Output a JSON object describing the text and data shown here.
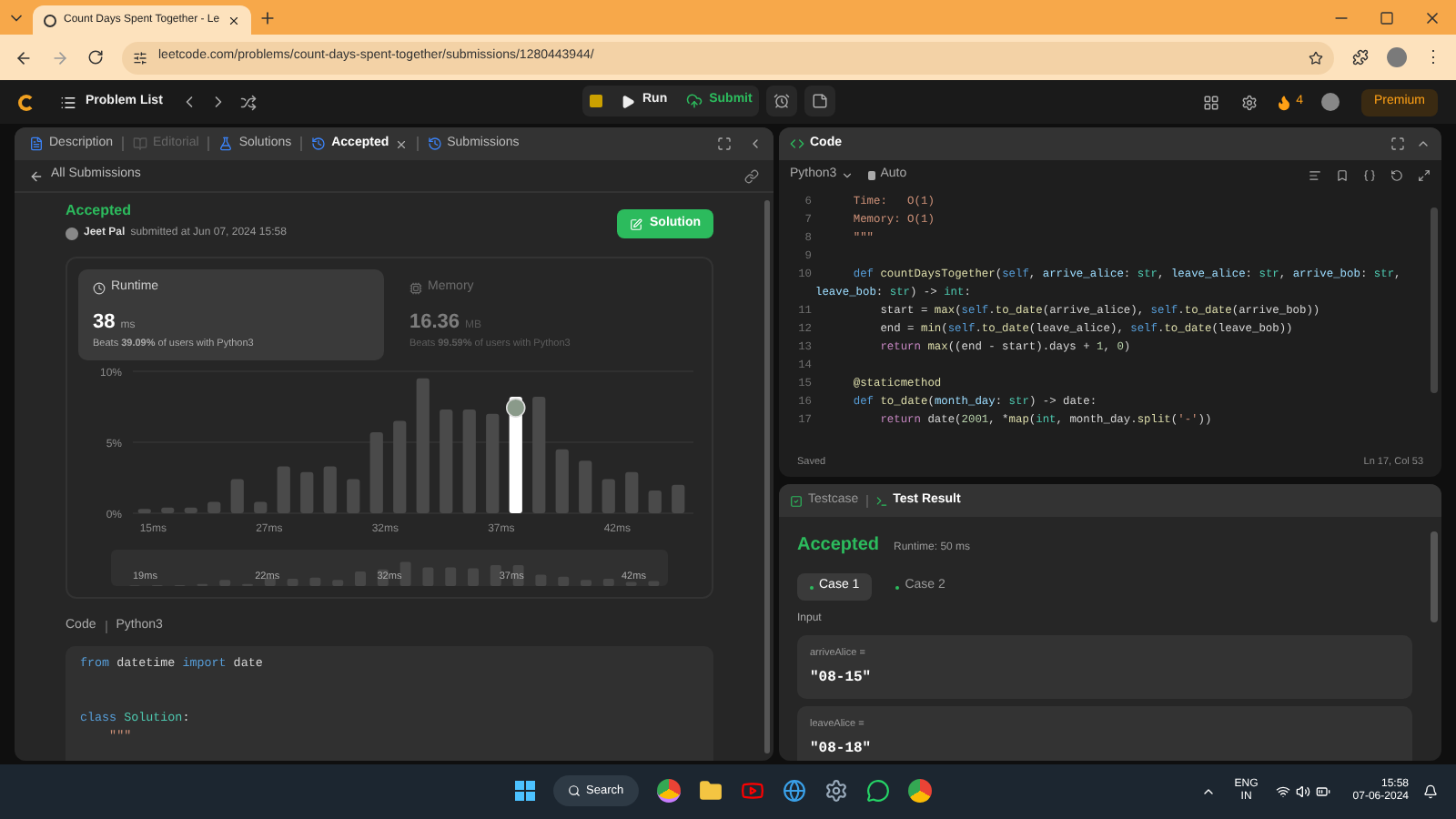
{
  "browser": {
    "tab_title": "Count Days Spent Together - Le",
    "url": "leetcode.com/problems/count-days-spent-together/submissions/1280443944/",
    "menu": "⋮"
  },
  "nav": {
    "problem_list": "Problem List",
    "run": "Run",
    "submit": "Submit",
    "streak": "4",
    "premium": "Premium"
  },
  "left_tabs": [
    {
      "label": "Description",
      "selected": false,
      "disabled": false
    },
    {
      "label": "Editorial",
      "selected": false,
      "disabled": true
    },
    {
      "label": "Solutions",
      "selected": false,
      "disabled": false
    },
    {
      "label": "Accepted",
      "selected": true,
      "disabled": false
    },
    {
      "label": "Submissions",
      "selected": false,
      "disabled": false
    }
  ],
  "back_link": "All Submissions",
  "submission": {
    "status": "Accepted",
    "user": "Jeet Pal",
    "submitted": "submitted at Jun 07, 2024 15:58",
    "solution_button": "Solution"
  },
  "stats": [
    {
      "title": "Runtime",
      "value": "38",
      "unit": "ms",
      "beats": "Beats **39.09%** of users with Python3",
      "selected": true
    },
    {
      "title": "Memory",
      "value": "16.36",
      "unit": "MB",
      "beats": "Beats **99.59%** of users with Python3",
      "selected": false
    }
  ],
  "chart_data": {
    "type": "bar",
    "categories": [
      "15ms",
      null,
      null,
      null,
      null,
      "27ms",
      null,
      null,
      null,
      null,
      "32ms",
      null,
      null,
      null,
      null,
      "37ms",
      null,
      null,
      null,
      null,
      "42ms",
      null,
      null,
      null
    ],
    "series": [
      {
        "color": "#4a4a4a",
        "values": [
          0.3,
          0.4,
          0.4,
          0.8,
          2.4,
          0.8,
          3.3,
          2.9,
          3.3,
          2.4,
          5.7,
          6.5,
          9.5,
          7.3,
          7.3,
          7.0,
          null,
          8.2,
          4.5,
          3.7,
          2.4,
          2.9,
          1.6,
          2.0
        ]
      },
      {
        "color": "#ffffff",
        "values": [
          null,
          null,
          null,
          null,
          null,
          null,
          null,
          null,
          null,
          null,
          null,
          null,
          null,
          null,
          null,
          null,
          8.2,
          null,
          null,
          null,
          null,
          null,
          null,
          null
        ]
      }
    ],
    "ylim": [
      0,
      10
    ],
    "yticks": [
      {
        "value": 0,
        "label": "0%"
      },
      {
        "value": 5,
        "label": "5%"
      },
      {
        "value": 10,
        "label": "10%"
      }
    ]
  },
  "range_labels": [
    "19ms",
    "22ms",
    "32ms",
    "37ms",
    "42ms"
  ],
  "left_code": {
    "label": "Code",
    "language": "Python3",
    "lines": [
      {
        "tokens": [
          {
            "text": "from",
            "kind": "kw"
          },
          {
            "text": " datetime ",
            "kind": "plain"
          },
          {
            "text": "import",
            "kind": "kw"
          },
          {
            "text": " date",
            "kind": "plain"
          }
        ]
      },
      {
        "kind": "blank"
      },
      {
        "kind": "blank"
      },
      {
        "kind": "code",
        "tokens": [
          {
            "text": "class ",
            "kind": "kw"
          },
          {
            "text": "Solution",
            "kind": "cls"
          },
          {
            "text": ":",
            "kind": "plain"
          }
        ]
      },
      {
        "tokens": [
          {
            "text": "    \"\"\"",
            "kind": "str"
          }
        ]
      }
    ]
  },
  "code_panel": {
    "title": "Code",
    "language": "Python3",
    "mode": "Auto",
    "status": "Saved",
    "cursor": "Ln 17, Col 53",
    "lines": [
      {
        "num": "6",
        "tokens": [
          {
            "text": "    Time:   O(1)",
            "kind": "str"
          }
        ]
      },
      {
        "num": "7",
        "tokens": [
          {
            "text": "    Memory: O(1)",
            "kind": "str"
          }
        ]
      },
      {
        "num": "8",
        "tokens": [
          {
            "text": "    \"\"\"",
            "kind": "str"
          }
        ]
      },
      {
        "num": "9"
      },
      {
        "num": "10",
        "tokens": [
          {
            "text": "    def ",
            "kind": "kw"
          },
          {
            "text": "countDaysTogether",
            "kind": "fn"
          },
          {
            "text": "(",
            "kind": "plain"
          },
          {
            "text": "self",
            "kind": "kw"
          },
          {
            "text": ", ",
            "kind": "plain"
          },
          {
            "text": "arrive_alice",
            "kind": "var"
          },
          {
            "text": ": ",
            "kind": "plain"
          },
          {
            "text": "str",
            "kind": "cls"
          },
          {
            "text": ", ",
            "kind": "plain"
          },
          {
            "text": "leave_alice",
            "kind": "var"
          },
          {
            "text": ": ",
            "kind": "plain"
          },
          {
            "text": "str",
            "kind": "cls"
          },
          {
            "text": ", ",
            "kind": "plain"
          },
          {
            "text": "arrive_bob",
            "kind": "var"
          },
          {
            "text": ": ",
            "kind": "plain"
          },
          {
            "text": "str",
            "kind": "cls"
          },
          {
            "text": ",",
            "kind": "plain"
          }
        ]
      },
      {
        "tokens": [
          {
            "text": "leave_bob",
            "kind": "var"
          },
          {
            "text": ": ",
            "kind": "plain"
          },
          {
            "text": "str",
            "kind": "cls"
          },
          {
            "text": ") -> ",
            "kind": "plain"
          },
          {
            "text": "int",
            "kind": "cls"
          },
          {
            "text": ":",
            "kind": "plain"
          }
        ]
      },
      {
        "num": "11",
        "tokens": [
          {
            "text": "        start = ",
            "kind": "plain"
          },
          {
            "text": "max",
            "kind": "fn"
          },
          {
            "text": "(",
            "kind": "plain"
          },
          {
            "text": "self",
            "kind": "kw"
          },
          {
            "text": ".",
            "kind": "plain"
          },
          {
            "text": "to_date",
            "kind": "fn"
          },
          {
            "text": "(arrive_alice), ",
            "kind": "plain"
          },
          {
            "text": "self",
            "kind": "kw"
          },
          {
            "text": ".",
            "kind": "plain"
          },
          {
            "text": "to_date",
            "kind": "fn"
          },
          {
            "text": "(arrive_bob))",
            "kind": "plain"
          }
        ]
      },
      {
        "num": "12",
        "tokens": [
          {
            "text": "        end = ",
            "kind": "plain"
          },
          {
            "text": "min",
            "kind": "fn"
          },
          {
            "text": "(",
            "kind": "plain"
          },
          {
            "text": "self",
            "kind": "kw"
          },
          {
            "text": ".",
            "kind": "plain"
          },
          {
            "text": "to_date",
            "kind": "fn"
          },
          {
            "text": "(leave_alice), ",
            "kind": "plain"
          },
          {
            "text": "self",
            "kind": "kw"
          },
          {
            "text": ".",
            "kind": "plain"
          },
          {
            "text": "to_date",
            "kind": "fn"
          },
          {
            "text": "(leave_bob))",
            "kind": "plain"
          }
        ]
      },
      {
        "num": "13",
        "tokens": [
          {
            "text": "        return ",
            "kind": "ctl"
          },
          {
            "text": "max",
            "kind": "fn"
          },
          {
            "text": "((end - start).days + ",
            "kind": "plain"
          },
          {
            "text": "1",
            "kind": "num"
          },
          {
            "text": ", ",
            "kind": "plain"
          },
          {
            "text": "0",
            "kind": "num"
          },
          {
            "text": ")",
            "kind": "plain"
          }
        ]
      },
      {
        "num": "14"
      },
      {
        "num": "15",
        "tokens": [
          {
            "text": "    @staticmethod",
            "kind": "fn"
          }
        ]
      },
      {
        "num": "16",
        "tokens": [
          {
            "text": "    def ",
            "kind": "kw"
          },
          {
            "text": "to_date",
            "kind": "fn"
          },
          {
            "text": "(",
            "kind": "plain"
          },
          {
            "text": "month_day",
            "kind": "var"
          },
          {
            "text": ": ",
            "kind": "plain"
          },
          {
            "text": "str",
            "kind": "cls"
          },
          {
            "text": ") -> date:",
            "kind": "plain"
          }
        ]
      },
      {
        "num": "17",
        "tokens": [
          {
            "text": "        return",
            "kind": "ctl"
          },
          {
            "text": " date(",
            "kind": "plain"
          },
          {
            "text": "2001",
            "kind": "num"
          },
          {
            "text": ", *",
            "kind": "plain"
          },
          {
            "text": "map",
            "kind": "fn"
          },
          {
            "text": "(",
            "kind": "plain"
          },
          {
            "text": "int",
            "kind": "cls"
          },
          {
            "text": ", month_day.",
            "kind": "plain"
          },
          {
            "text": "split",
            "kind": "fn"
          },
          {
            "text": "(",
            "kind": "plain"
          },
          {
            "text": "'-'",
            "kind": "str"
          },
          {
            "text": "))",
            "kind": "plain"
          }
        ]
      }
    ]
  },
  "result_tabs": [
    {
      "label": "Testcase",
      "selected": false
    },
    {
      "label": "Test Result",
      "selected": true
    }
  ],
  "result": {
    "status": "Accepted",
    "runtime": "Runtime: 50 ms",
    "input_label": "Input"
  },
  "cases": [
    {
      "label": "Case 1",
      "selected": true
    },
    {
      "label": "Case 2",
      "selected": false
    }
  ],
  "inputs": [
    {
      "name": "arriveAlice =",
      "value": "\"08-15\""
    },
    {
      "name": "leaveAlice =",
      "value": "\"08-18\""
    }
  ],
  "taskbar": {
    "search": "Search",
    "language": "ENG",
    "region": "IN",
    "time": "15:58",
    "date": "07-06-2024"
  }
}
